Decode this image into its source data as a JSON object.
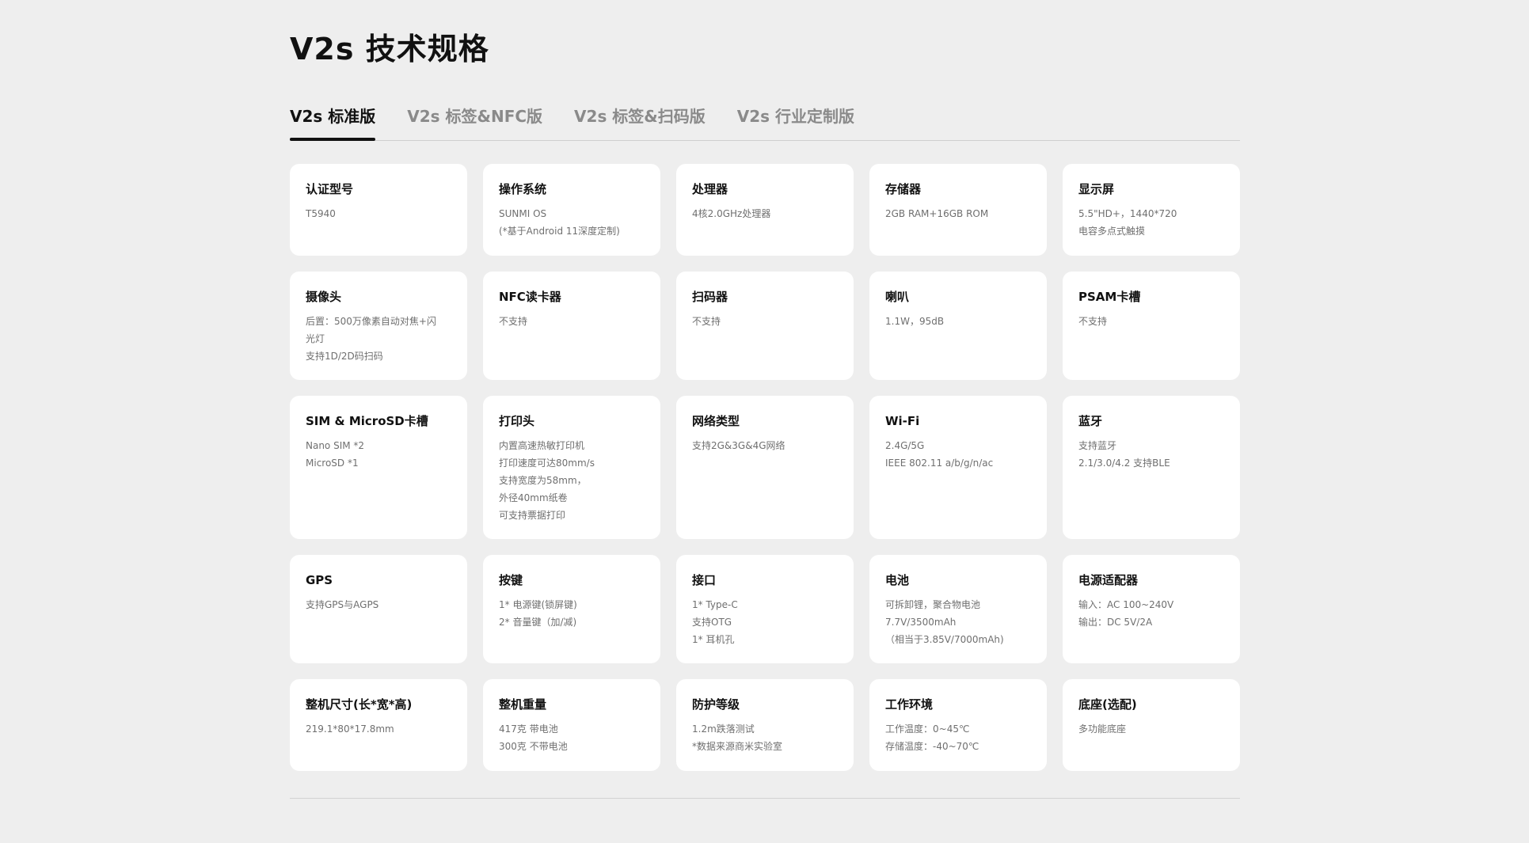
{
  "page": {
    "title": "V2s 技术规格"
  },
  "tabs": [
    {
      "label": "V2s 标准版",
      "active": true
    },
    {
      "label": "V2s 标签&NFC版",
      "active": false
    },
    {
      "label": "V2s 标签&扫码版",
      "active": false
    },
    {
      "label": "V2s 行业定制版",
      "active": false
    }
  ],
  "specs": [
    {
      "title": "认证型号",
      "lines": [
        "T5940"
      ]
    },
    {
      "title": "操作系统",
      "lines": [
        "SUNMI OS",
        "(*基于Android 11深度定制)"
      ]
    },
    {
      "title": "处理器",
      "lines": [
        "4核2.0GHz处理器"
      ]
    },
    {
      "title": "存储器",
      "lines": [
        "2GB RAM+16GB ROM"
      ]
    },
    {
      "title": "显示屏",
      "lines": [
        "5.5\"HD+，1440*720",
        "电容多点式触摸"
      ]
    },
    {
      "title": "摄像头",
      "lines": [
        "后置：500万像素自动对焦+闪",
        "光灯",
        "支持1D/2D码扫码"
      ]
    },
    {
      "title": "NFC读卡器",
      "lines": [
        "不支持"
      ]
    },
    {
      "title": "扫码器",
      "lines": [
        "不支持"
      ]
    },
    {
      "title": "喇叭",
      "lines": [
        "1.1W，95dB"
      ]
    },
    {
      "title": "PSAM卡槽",
      "lines": [
        "不支持"
      ]
    },
    {
      "title": "SIM & MicroSD卡槽",
      "lines": [
        "Nano SIM *2",
        "MicroSD *1"
      ]
    },
    {
      "title": "打印头",
      "lines": [
        "内置高速热敏打印机",
        "打印速度可达80mm/s",
        "支持宽度为58mm，",
        "外径40mm纸卷",
        "可支持票据打印"
      ]
    },
    {
      "title": "网络类型",
      "lines": [
        "支持2G&3G&4G网络"
      ]
    },
    {
      "title": "Wi-Fi",
      "lines": [
        "2.4G/5G",
        "IEEE 802.11 a/b/g/n/ac"
      ]
    },
    {
      "title": "蓝牙",
      "lines": [
        "支持蓝牙",
        "2.1/3.0/4.2 支持BLE"
      ]
    },
    {
      "title": "GPS",
      "lines": [
        "支持GPS与AGPS"
      ]
    },
    {
      "title": "按键",
      "lines": [
        "1* 电源键(锁屏键)",
        "2* 音量键（加/减)"
      ]
    },
    {
      "title": "接口",
      "lines": [
        "1* Type-C",
        "支持OTG",
        "1* 耳机孔"
      ]
    },
    {
      "title": "电池",
      "lines": [
        "可拆卸锂，聚合物电池",
        "7.7V/3500mAh",
        "（相当于3.85V/7000mAh)"
      ]
    },
    {
      "title": "电源适配器",
      "lines": [
        "输入：AC 100~240V",
        "输出：DC 5V/2A"
      ]
    },
    {
      "title": "整机尺寸(长*宽*高)",
      "lines": [
        "219.1*80*17.8mm"
      ]
    },
    {
      "title": "整机重量",
      "lines": [
        "417克 带电池",
        "300克 不带电池"
      ]
    },
    {
      "title": "防护等级",
      "lines": [
        "1.2m跌落测试",
        "*数据来源商米实验室"
      ]
    },
    {
      "title": "工作环境",
      "lines": [
        "工作温度：0~45℃",
        "存储温度：-40~70℃"
      ]
    },
    {
      "title": "底座(选配)",
      "lines": [
        "多功能底座"
      ]
    }
  ]
}
